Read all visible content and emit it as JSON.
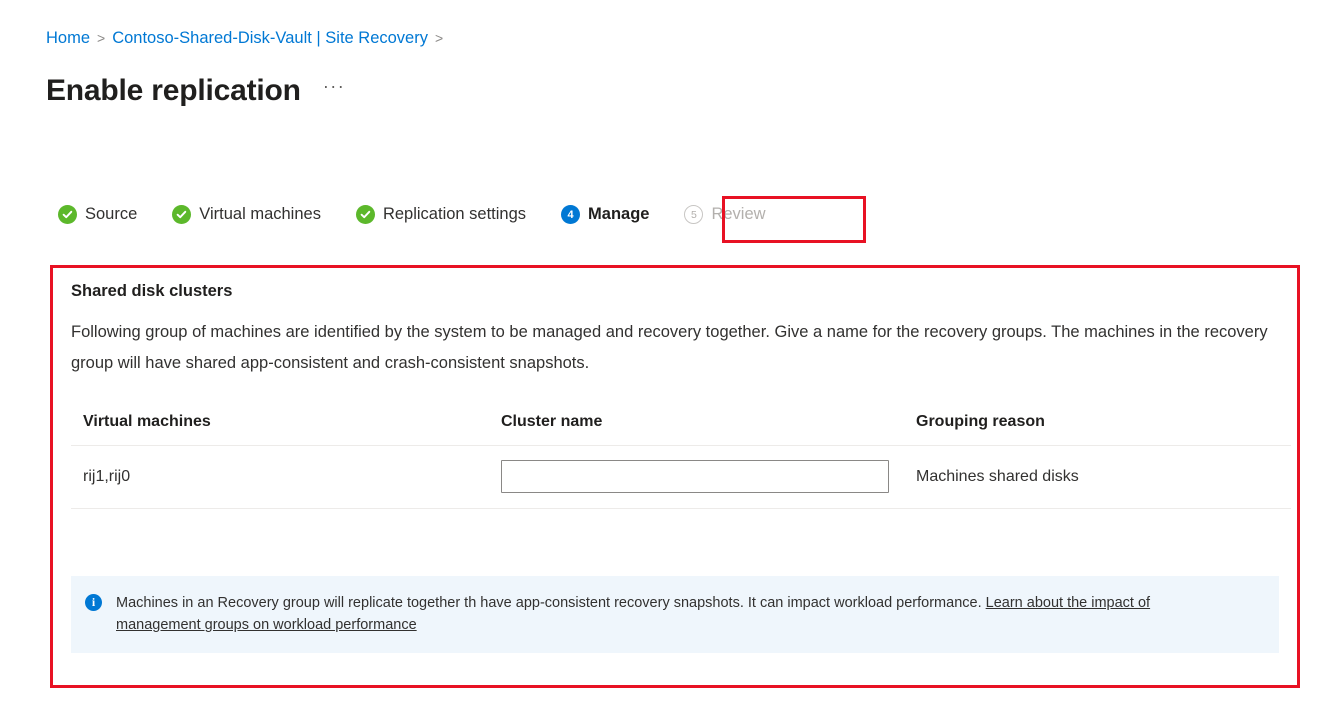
{
  "breadcrumb": {
    "items": [
      {
        "label": "Home"
      },
      {
        "label": "Contoso-Shared-Disk-Vault | Site Recovery"
      }
    ],
    "separator": ">"
  },
  "header": {
    "title": "Enable replication",
    "more_label": "···"
  },
  "wizard": {
    "steps": [
      {
        "label": "Source",
        "state": "done",
        "marker": "✓"
      },
      {
        "label": "Virtual machines",
        "state": "done",
        "marker": "✓"
      },
      {
        "label": "Replication settings",
        "state": "done",
        "marker": "✓"
      },
      {
        "label": "Manage",
        "state": "current",
        "marker": "4"
      },
      {
        "label": "Review",
        "state": "pending",
        "marker": "5"
      }
    ],
    "highlight_color": "#e81123"
  },
  "panel": {
    "section_title": "Shared disk clusters",
    "description": "Following group of machines are identified by the system to be managed and recovery together. Give a name for the recovery groups. The machines in the recovery group will have shared app-consistent and crash-consistent snapshots.",
    "table": {
      "columns": [
        "Virtual machines",
        "Cluster name",
        "Grouping reason"
      ],
      "rows": [
        {
          "virtual_machines": "rij1,rij0",
          "cluster_name_value": "",
          "cluster_name_placeholder": "",
          "grouping_reason": "Machines shared disks"
        }
      ]
    },
    "info": {
      "icon": "info-icon",
      "text_before_link": "Machines in an Recovery group will replicate together th have app-consistent recovery snapshots. It can impact workload performance. ",
      "link_text": "Learn about the impact of management groups on workload performance",
      "background": "#eff6fc",
      "accent": "#0078d4"
    }
  },
  "colors": {
    "link": "#0078d4",
    "success": "#5cb82b",
    "current": "#0078d4",
    "disabled": "#b3b0ad",
    "red_highlight": "#e81123"
  }
}
